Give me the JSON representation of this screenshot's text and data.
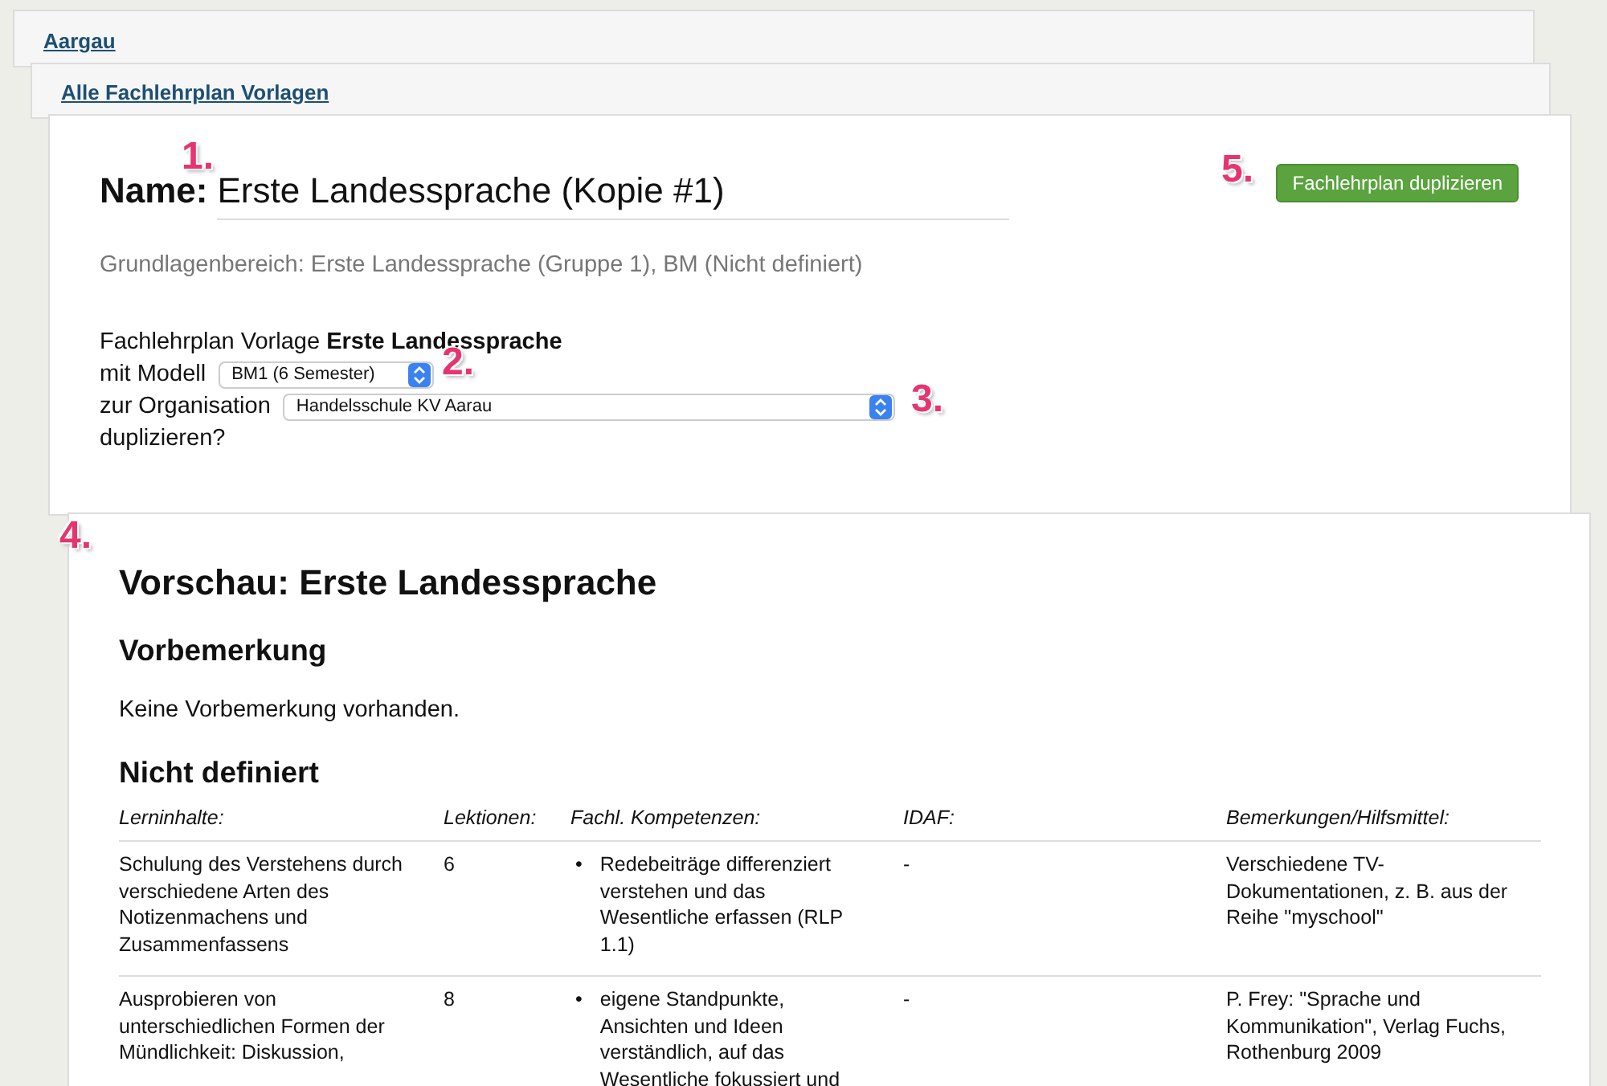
{
  "breadcrumbs": [
    {
      "label": "Aargau"
    },
    {
      "label": "Alle Fachlehrplan Vorlagen"
    }
  ],
  "form": {
    "name_label": "Name:",
    "name_value": "Erste Landessprache (Kopie #1)",
    "duplicate_button": "Fachlehrplan duplizieren",
    "info": "Grundlagenbereich: Erste Landessprache (Gruppe 1), BM (Nicht definiert)",
    "sentence_1": "Fachlehrplan Vorlage **Erste Landessprache**",
    "model_label": "mit Modell",
    "model_value": "BM1 (6 Semester)",
    "org_label": "zur Organisation",
    "org_value": "Handelsschule KV Aarau",
    "sentence_end": "duplizieren?"
  },
  "markers": [
    {
      "label": "1."
    },
    {
      "label": "2."
    },
    {
      "label": "3."
    },
    {
      "label": "4."
    },
    {
      "label": "5."
    }
  ],
  "preview": {
    "title": "Vorschau: Erste Landessprache",
    "intro_heading": "Vorbemerkung",
    "intro_text": "Keine Vorbemerkung vorhanden.",
    "section_heading": "Nicht definiert",
    "table": {
      "columns": [
        "Lerninhalte:",
        "Lektionen:",
        "Fachl. Kompetenzen:",
        "IDAF:",
        "Bemerkungen/Hilfsmittel:"
      ],
      "rows": [
        {
          "content": "Schulung des Verstehens durch verschiedene Arten des Notizenmachens und Zusammenfassens",
          "lessons": "6",
          "competences": [
            {
              "bullet": "•",
              "text": "Redebeiträge differenziert verstehen und das Wesentliche erfassen (RLP 1.1)"
            }
          ],
          "idaf": "-",
          "notes": "Verschiedene TV-Dokumentationen, z. B. aus der Reihe \"myschool\""
        },
        {
          "content": "Ausprobieren von unterschiedlichen Formen der Mündlichkeit: Diskussion,",
          "lessons": "8",
          "competences": [
            {
              "bullet": "•",
              "text": "eigene Standpunkte, Ansichten und Ideen verständlich, auf das Wesentliche fokussiert und"
            }
          ],
          "idaf": "-",
          "notes": "P. Frey: \"Sprache und Kommunikation\", Verlag Fuchs, Rothenburg 2009"
        }
      ]
    }
  }
}
